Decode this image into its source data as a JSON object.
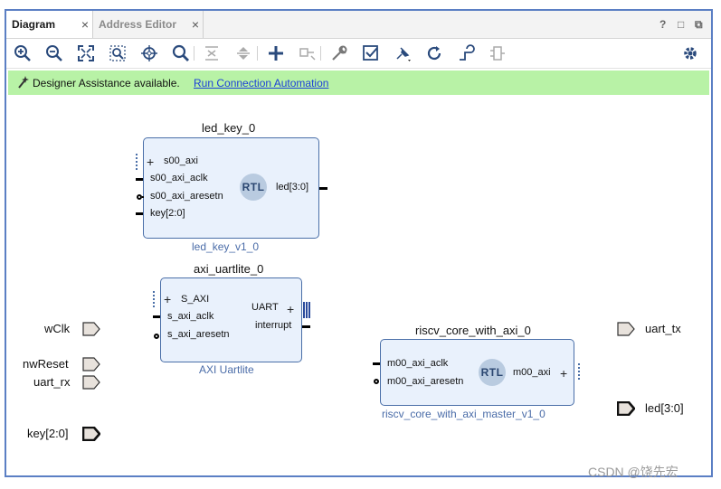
{
  "tabs": [
    {
      "label": "Diagram",
      "close": "×"
    },
    {
      "label": "Address Editor",
      "close": "×"
    }
  ],
  "window_controls": [
    "?",
    "□",
    "⧉"
  ],
  "toolbar": {
    "icons": [
      "zoom-in-icon",
      "zoom-out-icon",
      "fit-icon",
      "zoom-area-icon",
      "auto-fit-icon",
      "search-icon",
      "collapse-icon",
      "expand-icon",
      "add-ip-icon",
      "make-connection-icon",
      "properties-icon",
      "validate-icon",
      "pin-icon",
      "regenerate-icon",
      "optimize-routing-icon",
      "relayout-icon",
      "settings-icon"
    ]
  },
  "banner": {
    "text": "Designer Assistance available.",
    "link": "Run Connection Automation",
    "color": "#b8f2a6"
  },
  "blocks": {
    "led_key": {
      "title": "led_key_0",
      "subtitle": "led_key_v1_0",
      "badge": "RTL",
      "left_ports": [
        "s00_axi",
        "s00_axi_aclk",
        "s00_axi_aresetn",
        "key[2:0]"
      ],
      "right_ports": [
        "led[3:0]"
      ]
    },
    "axi_uartlite": {
      "title": "axi_uartlite_0",
      "subtitle": "AXI Uartlite",
      "left_ports": [
        "S_AXI",
        "s_axi_aclk",
        "s_axi_aresetn"
      ],
      "right_ports": [
        "UART",
        "interrupt"
      ]
    },
    "riscv": {
      "title": "riscv_core_with_axi_0",
      "subtitle": "riscv_core_with_axi_master_v1_0",
      "badge": "RTL",
      "left_ports": [
        "m00_axi_aclk",
        "m00_axi_aresetn"
      ],
      "right_ports": [
        "m00_axi"
      ]
    }
  },
  "external_ports": {
    "inputs": [
      "wClk",
      "nwReset",
      "uart_rx",
      "key[2:0]"
    ],
    "outputs": [
      "uart_tx",
      "led[3:0]"
    ]
  },
  "watermark": "CSDN @饶先宏"
}
